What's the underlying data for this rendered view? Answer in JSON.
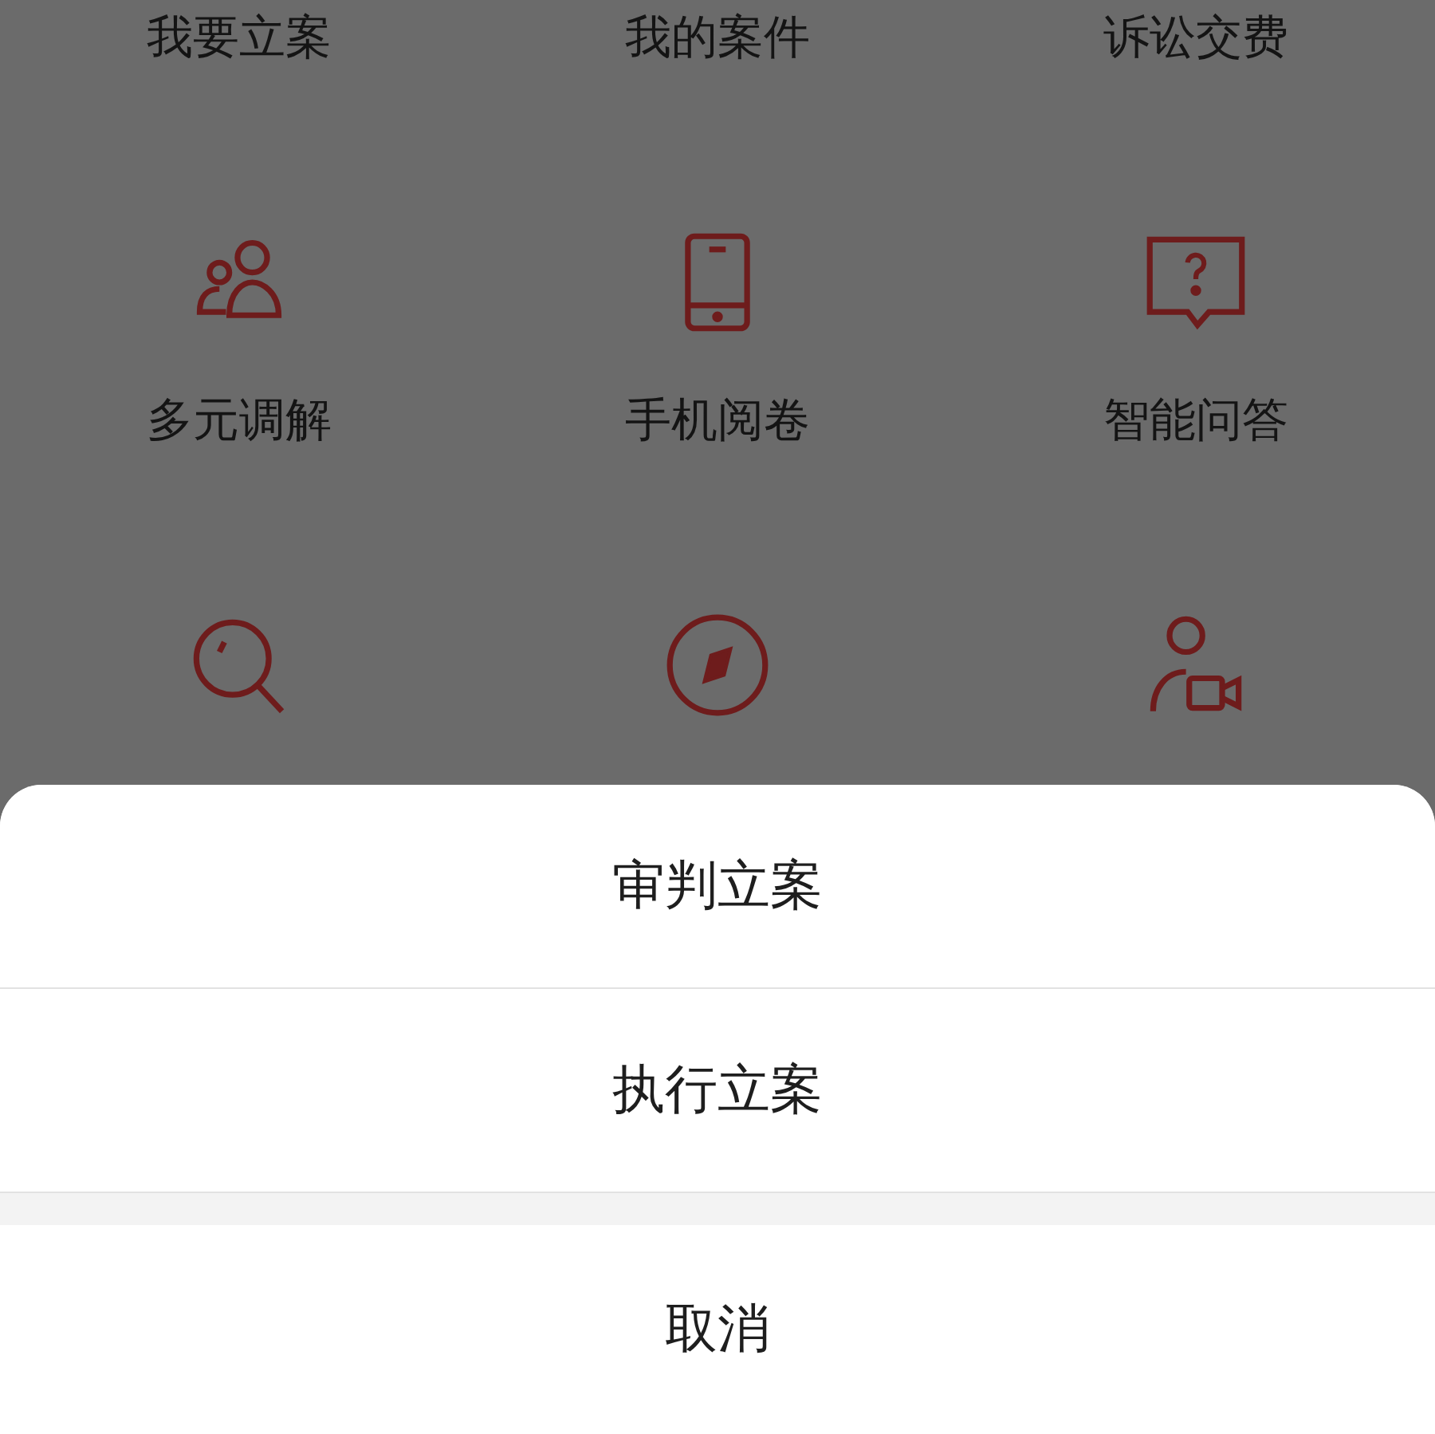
{
  "grid": [
    {
      "label": "我要立案"
    },
    {
      "label": "我的案件"
    },
    {
      "label": "诉讼交费"
    },
    {
      "label": "多元调解",
      "kind": "people"
    },
    {
      "label": "手机阅卷",
      "kind": "tablet"
    },
    {
      "label": "智能问答",
      "kind": "question"
    },
    {
      "kind": "search"
    },
    {
      "kind": "compass"
    },
    {
      "kind": "agent"
    }
  ],
  "action_sheet": {
    "options": [
      "审判立案",
      "执行立案"
    ],
    "cancel": "取消"
  }
}
